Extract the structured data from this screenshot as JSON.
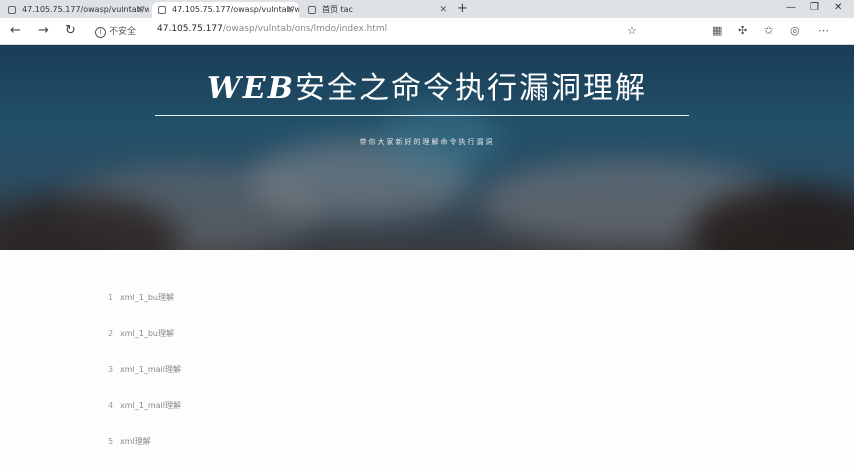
{
  "tabs": [
    {
      "title": "47.105.75.177/owasp/vulntab/w"
    },
    {
      "title": "47.105.75.177/owasp/vulntab/w"
    },
    {
      "title": "首页 tac"
    }
  ],
  "window_controls": {
    "minimize": "—",
    "maximize": "❐",
    "close": "✕"
  },
  "address": {
    "security_label": "不安全",
    "url_host": "47.105.75.177",
    "url_path": "/owasp/vulntab/ons/lmdo/index.html"
  },
  "hero": {
    "title_brand": "WEB",
    "title_rest": "安全之命令执行漏洞理解",
    "subtitle": "带你大家新好的理解命令执行漏洞"
  },
  "list": [
    {
      "num": "1",
      "label": "xml_1_bu理解"
    },
    {
      "num": "2",
      "label": "xml_1_bu理解"
    },
    {
      "num": "3",
      "label": "xml_1_mail理解"
    },
    {
      "num": "4",
      "label": "xml_1_mail理解"
    },
    {
      "num": "5",
      "label": "xml理解"
    }
  ]
}
